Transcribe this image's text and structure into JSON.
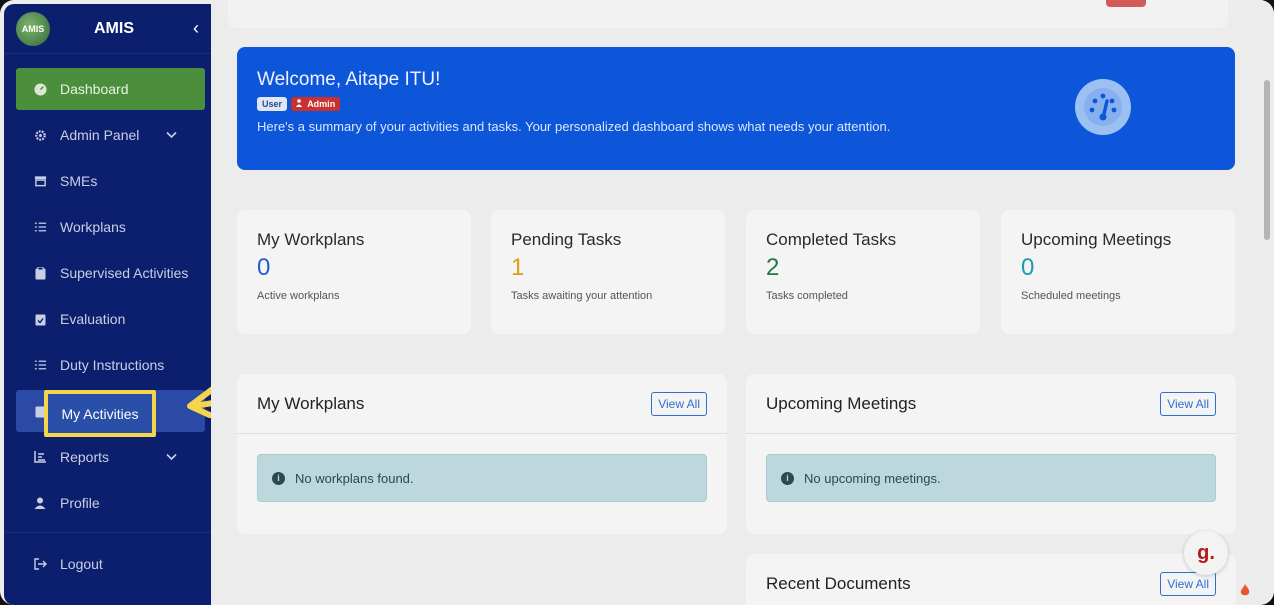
{
  "sidebar": {
    "logo_text": "AMIS",
    "brand": "AMIS",
    "collapse_icon": "‹",
    "items": [
      {
        "label": "Dashboard",
        "icon": "gauge-icon"
      },
      {
        "label": "Admin Panel",
        "icon": "gear-icon"
      },
      {
        "label": "SMEs",
        "icon": "store-icon"
      },
      {
        "label": "Workplans",
        "icon": "list-icon"
      },
      {
        "label": "Supervised Activities",
        "icon": "clipboard-icon"
      },
      {
        "label": "Evaluation",
        "icon": "clipboard-check-icon"
      },
      {
        "label": "Duty Instructions",
        "icon": "list-icon"
      },
      {
        "label": "My Activities",
        "icon": "clipboard-icon"
      },
      {
        "label": "Reports",
        "icon": "chart-icon"
      },
      {
        "label": "Profile",
        "icon": "user-icon"
      }
    ],
    "logout": "Logout"
  },
  "welcome": {
    "title": "Welcome, Aitape ITU!",
    "badge_user": "User",
    "badge_admin": "Admin",
    "message": "Here's a summary of your activities and tasks. Your personalized dashboard shows what needs your attention."
  },
  "stats": [
    {
      "title": "My Workplans",
      "value": "0",
      "desc": "Active workplans",
      "color": "#1d5fd0"
    },
    {
      "title": "Pending Tasks",
      "value": "1",
      "desc": "Tasks awaiting your attention",
      "color": "#d9a014"
    },
    {
      "title": "Completed Tasks",
      "value": "2",
      "desc": "Tasks completed",
      "color": "#1f7a43"
    },
    {
      "title": "Upcoming Meetings",
      "value": "0",
      "desc": "Scheduled meetings",
      "color": "#1a9bb5"
    }
  ],
  "panels": {
    "workplans": {
      "title": "My Workplans",
      "button": "View All",
      "empty": "No workplans found."
    },
    "meetings": {
      "title": "Upcoming Meetings",
      "button": "View All",
      "empty": "No upcoming meetings."
    },
    "documents": {
      "title": "Recent Documents",
      "button": "View All"
    }
  },
  "fab_label": "g.",
  "colors": {
    "sidebar_bg": "#0c1f6e",
    "active_item": "#4b8f3c",
    "welcome_bg": "#0d56d9",
    "highlight": "#f7d54a"
  }
}
